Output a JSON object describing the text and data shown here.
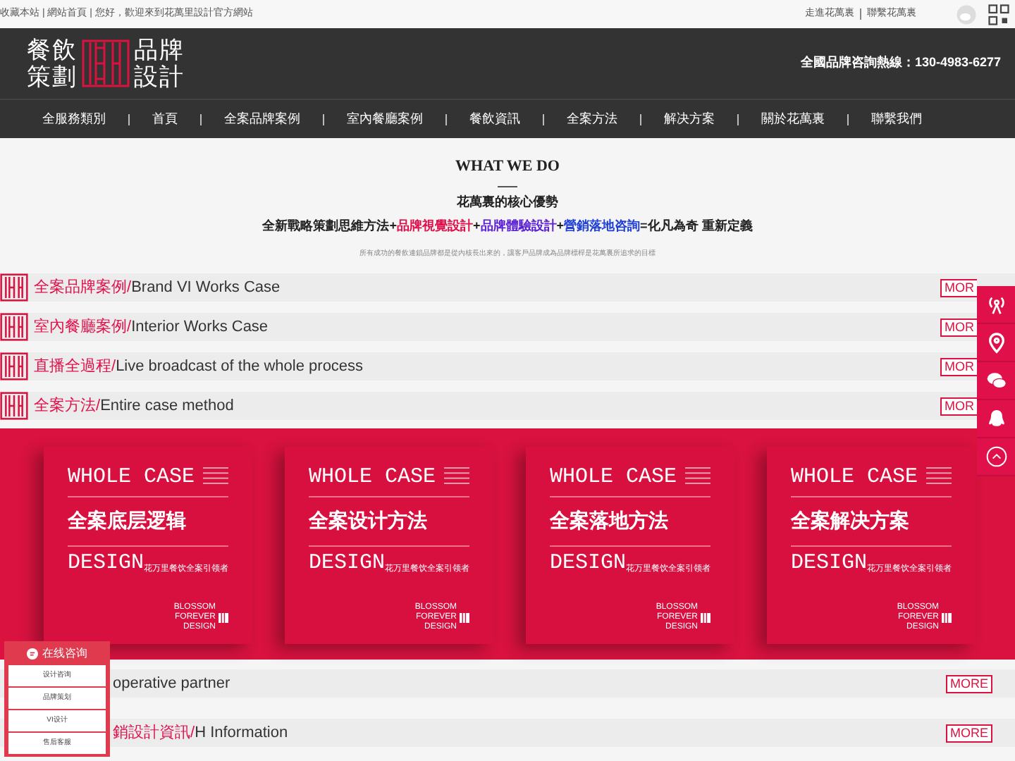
{
  "top_bar": {
    "left_text": "收藏本站 | 網站首頁 | 您好，歡迎來到花萬里設計官方網站",
    "right_links": [
      "走進花萬裏",
      "聯繫花萬裏"
    ]
  },
  "header": {
    "logo_left": [
      "餐飲",
      "策劃"
    ],
    "logo_right": [
      "品牌",
      "設計"
    ],
    "hotline": "全國品牌咨詢熱線：130-4983-6277"
  },
  "nav": [
    "全服務類別",
    "首頁",
    "全案品牌案例",
    "室內餐廳案例",
    "餐飲資訊",
    "全案方法",
    "解决方案",
    "關於花萬裏",
    "聯繫我們"
  ],
  "intro": {
    "title": "WHAT WE DO",
    "subtitle": "花萬裏的核心優勢",
    "slogan": [
      {
        "text": "全新戰略策劃思維方法+",
        "color": "#222222"
      },
      {
        "text": "品牌視覺設計",
        "color": "#e0104a"
      },
      {
        "text": "+",
        "color": "#222222"
      },
      {
        "text": "品牌體驗設計",
        "color": "#5a1fd6"
      },
      {
        "text": "+",
        "color": "#222222"
      },
      {
        "text": "營銷落地咨詢",
        "color": "#1f3fd6"
      },
      {
        "text": "=化凡為奇 重新定義",
        "color": "#222222"
      }
    ],
    "note": "所有成功的餐飲連鎖品牌都是從內核長出來的，讓客戶品牌成為品牌標桿是花萬裏所追求的目標"
  },
  "sections": [
    {
      "title_cn": "全案品牌案例/",
      "title_en": "Brand VI Works Case",
      "more": "MOR"
    },
    {
      "title_cn": "室內餐廳案例/",
      "title_en": "Interior Works Case",
      "more": "MOR"
    },
    {
      "title_cn": "直播全過程/",
      "title_en": "Live broadcast of the whole process",
      "more": "MOR"
    },
    {
      "title_cn": "全案方法/",
      "title_en": "Entire case method",
      "more": "MOR"
    }
  ],
  "books": [
    {
      "top": "WHOLE CASE",
      "title": "全案底层逻辑",
      "bottom": "DESIGN",
      "tagline": "花万里餐饮全案引领者",
      "brand": "BLOSSOM FOREVER DESIGN"
    },
    {
      "top": "WHOLE CASE",
      "title": "全案设计方法",
      "bottom": "DESIGN",
      "tagline": "花万里餐饮全案引领者",
      "brand": "BLOSSOM FOREVER DESIGN"
    },
    {
      "top": "WHOLE CASE",
      "title": "全案落地方法",
      "bottom": "DESIGN",
      "tagline": "花万里餐饮全案引领者",
      "brand": "BLOSSOM FOREVER DESIGN"
    },
    {
      "top": "WHOLE CASE",
      "title": "全案解决方案",
      "bottom": "DESIGN",
      "tagline": "花万里餐饮全案引领者",
      "brand": "BLOSSOM FOREVER DESIGN"
    }
  ],
  "lower_sections": [
    {
      "title_en": "operative partner",
      "more": "MORE"
    },
    {
      "title_cn": "銷設計資訊/",
      "title_en": "H Information",
      "more": "MORE"
    }
  ],
  "chat_widget": {
    "title": "在线咨询",
    "items": [
      "设计咨询",
      "品牌策划",
      "VI设计",
      "售后客服"
    ]
  }
}
